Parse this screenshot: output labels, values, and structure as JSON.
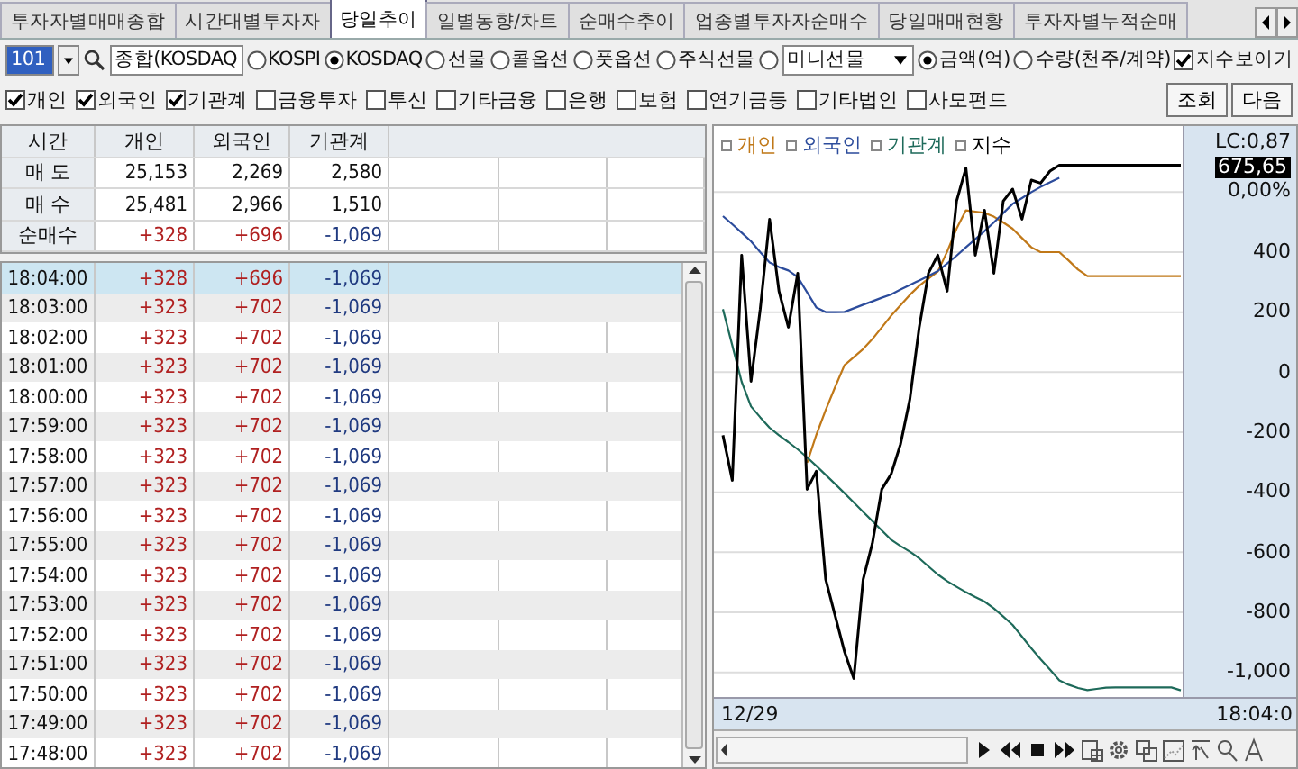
{
  "tabs": [
    {
      "label": "투자자별매매종합",
      "selected": false
    },
    {
      "label": "시간대별투자자",
      "selected": false
    },
    {
      "label": "당일추이",
      "selected": true
    },
    {
      "label": "일별동향/차트",
      "selected": false
    },
    {
      "label": "순매수추이",
      "selected": false
    },
    {
      "label": "업종별투자자순매수",
      "selected": false
    },
    {
      "label": "당일매매현황",
      "selected": false
    },
    {
      "label": "투자자별누적순매",
      "selected": false
    }
  ],
  "toolbar": {
    "code": "101",
    "market_name": "종합(KOSDAQ",
    "markets": [
      {
        "label": "KOSPI",
        "selected": false
      },
      {
        "label": "KOSDAQ",
        "selected": true
      },
      {
        "label": "선물",
        "selected": false
      },
      {
        "label": "콜옵션",
        "selected": false
      },
      {
        "label": "풋옵션",
        "selected": false
      },
      {
        "label": "주식선물",
        "selected": false
      },
      {
        "selected": false
      }
    ],
    "product": "미니선물",
    "units": [
      {
        "label": "금액(억)",
        "selected": true
      },
      {
        "label": "수량(천주/계약)",
        "selected": false
      }
    ],
    "show_index": {
      "label": "지수보이기",
      "checked": true
    }
  },
  "investors": [
    {
      "label": "개인",
      "checked": true
    },
    {
      "label": "외국인",
      "checked": true
    },
    {
      "label": "기관계",
      "checked": true
    },
    {
      "label": "금융투자",
      "checked": false
    },
    {
      "label": "투신",
      "checked": false
    },
    {
      "label": "기타금융",
      "checked": false
    },
    {
      "label": "은행",
      "checked": false
    },
    {
      "label": "보험",
      "checked": false
    },
    {
      "label": "연기금등",
      "checked": false
    },
    {
      "label": "기타법인",
      "checked": false
    },
    {
      "label": "사모펀드",
      "checked": false
    }
  ],
  "buttons": [
    "조회",
    "다음"
  ],
  "summary": {
    "columns": [
      "시간",
      "개인",
      "외국인",
      "기관계"
    ],
    "rows": [
      [
        "매 도",
        "25,153",
        "2,269",
        "2,580"
      ],
      [
        "매 수",
        "25,481",
        "2,966",
        "1,510"
      ],
      [
        "순매수",
        "+328",
        "+696",
        "-1,069"
      ]
    ]
  },
  "table": {
    "rows": [
      {
        "cells": [
          "18:04:00",
          "+328",
          "+696",
          "-1,069"
        ],
        "selected": true
      },
      {
        "cells": [
          "18:03:00",
          "+323",
          "+702",
          "-1,069"
        ],
        "selected": false
      },
      {
        "cells": [
          "18:02:00",
          "+323",
          "+702",
          "-1,069"
        ],
        "selected": false
      },
      {
        "cells": [
          "18:01:00",
          "+323",
          "+702",
          "-1,069"
        ],
        "selected": false
      },
      {
        "cells": [
          "18:00:00",
          "+323",
          "+702",
          "-1,069"
        ],
        "selected": false
      },
      {
        "cells": [
          "17:59:00",
          "+323",
          "+702",
          "-1,069"
        ],
        "selected": false
      },
      {
        "cells": [
          "17:58:00",
          "+323",
          "+702",
          "-1,069"
        ],
        "selected": false
      },
      {
        "cells": [
          "17:57:00",
          "+323",
          "+702",
          "-1,069"
        ],
        "selected": false
      },
      {
        "cells": [
          "17:56:00",
          "+323",
          "+702",
          "-1,069"
        ],
        "selected": false
      },
      {
        "cells": [
          "17:55:00",
          "+323",
          "+702",
          "-1,069"
        ],
        "selected": false
      },
      {
        "cells": [
          "17:54:00",
          "+323",
          "+702",
          "-1,069"
        ],
        "selected": false
      },
      {
        "cells": [
          "17:53:00",
          "+323",
          "+702",
          "-1,069"
        ],
        "selected": false
      },
      {
        "cells": [
          "17:52:00",
          "+323",
          "+702",
          "-1,069"
        ],
        "selected": false
      },
      {
        "cells": [
          "17:51:00",
          "+323",
          "+702",
          "-1,069"
        ],
        "selected": false
      },
      {
        "cells": [
          "17:50:00",
          "+323",
          "+702",
          "-1,069"
        ],
        "selected": false
      },
      {
        "cells": [
          "17:49:00",
          "+323",
          "+702",
          "-1,069"
        ],
        "selected": false
      },
      {
        "cells": [
          "17:48:00",
          "+323",
          "+702",
          "-1,069"
        ],
        "selected": false
      }
    ]
  },
  "chart": {
    "lc": "LC:0,87",
    "current": "675,65",
    "change": "0,00%",
    "chart_data": {
      "type": "line",
      "ylim": [
        -1100,
        820
      ],
      "grid": true,
      "yticks": [
        {
          "value": 400,
          "label": "400"
        },
        {
          "value": 200,
          "label": "200"
        },
        {
          "value": 0,
          "label": "0"
        },
        {
          "value": -200,
          "label": "-200"
        },
        {
          "value": -400,
          "label": "-400"
        },
        {
          "value": -600,
          "label": "-600"
        },
        {
          "value": -800,
          "label": "-800"
        },
        {
          "value": -1000,
          "label": "-1,000"
        }
      ],
      "series": [
        {
          "name": "개인",
          "color": "#c07818",
          "values": [
            null,
            null,
            null,
            null,
            null,
            null,
            null,
            null,
            null,
            -302,
            -209,
            -126,
            -50,
            23,
            50,
            77,
            110,
            149,
            188,
            223,
            258,
            288,
            312,
            335,
            402,
            478,
            539,
            535,
            531,
            518,
            499,
            478,
            447,
            416,
            400,
            400,
            400,
            372,
            342,
            320,
            320,
            320,
            320,
            320,
            320,
            320,
            320,
            320,
            320,
            320
          ]
        },
        {
          "name": "외국인",
          "color": "#2c4c9c",
          "values": [
            520,
            493,
            465,
            436,
            400,
            365,
            350,
            339,
            317,
            266,
            216,
            200,
            200,
            201,
            213,
            225,
            236,
            248,
            259,
            275,
            290,
            306,
            321,
            337,
            362,
            388,
            416,
            443,
            470,
            499,
            530,
            561,
            580,
            600,
            617,
            633,
            648,
            null,
            null,
            null,
            null,
            null,
            null,
            null,
            null,
            null,
            null,
            null,
            null,
            null
          ]
        },
        {
          "name": "기관계",
          "color": "#1e6a5a",
          "values": [
            210,
            89,
            -32,
            -114,
            -150,
            -185,
            -210,
            -233,
            -257,
            -284,
            -312,
            -342,
            -372,
            -403,
            -434,
            -466,
            -496,
            -527,
            -558,
            -579,
            -598,
            -620,
            -647,
            -674,
            -696,
            -715,
            -733,
            -749,
            -764,
            -787,
            -814,
            -842,
            -881,
            -920,
            -956,
            -991,
            -1026,
            -1041,
            -1052,
            -1059,
            -1055,
            -1051,
            -1050,
            -1050,
            -1050,
            -1050,
            -1050,
            -1050,
            -1050,
            -1060
          ]
        },
        {
          "name": "지수",
          "color": "#000000",
          "values": [
            -210,
            -360,
            390,
            -30,
            210,
            510,
            270,
            150,
            330,
            -390,
            -330,
            -690,
            -810,
            -930,
            -1020,
            -690,
            -570,
            -390,
            -340,
            -240,
            -90,
            150,
            330,
            390,
            270,
            570,
            680,
            390,
            540,
            330,
            570,
            610,
            510,
            640,
            630,
            670,
            690,
            690,
            690,
            690,
            690,
            690,
            690,
            690,
            690,
            690,
            690,
            690,
            690,
            690
          ]
        }
      ]
    },
    "start_label": "12/29",
    "end_label": "18:04:0"
  }
}
